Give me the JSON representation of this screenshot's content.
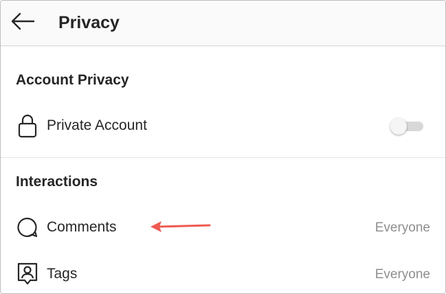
{
  "header": {
    "title": "Privacy",
    "back_icon": "back-arrow-icon"
  },
  "account_privacy": {
    "heading": "Account Privacy",
    "private_account": {
      "label": "Private Account",
      "icon": "lock-icon",
      "toggle_on": false
    }
  },
  "interactions": {
    "heading": "Interactions",
    "items": [
      {
        "label": "Comments",
        "value": "Everyone",
        "icon": "comment-bubble-icon"
      },
      {
        "label": "Tags",
        "value": "Everyone",
        "icon": "tag-person-icon"
      }
    ]
  },
  "annotation": {
    "arrow_color": "#ee5a52",
    "points_to": "Comments"
  },
  "colors": {
    "text": "#262626",
    "secondary_text": "#8e8e8e",
    "header_bg": "#fafafa",
    "divider": "#e6e6e6"
  }
}
